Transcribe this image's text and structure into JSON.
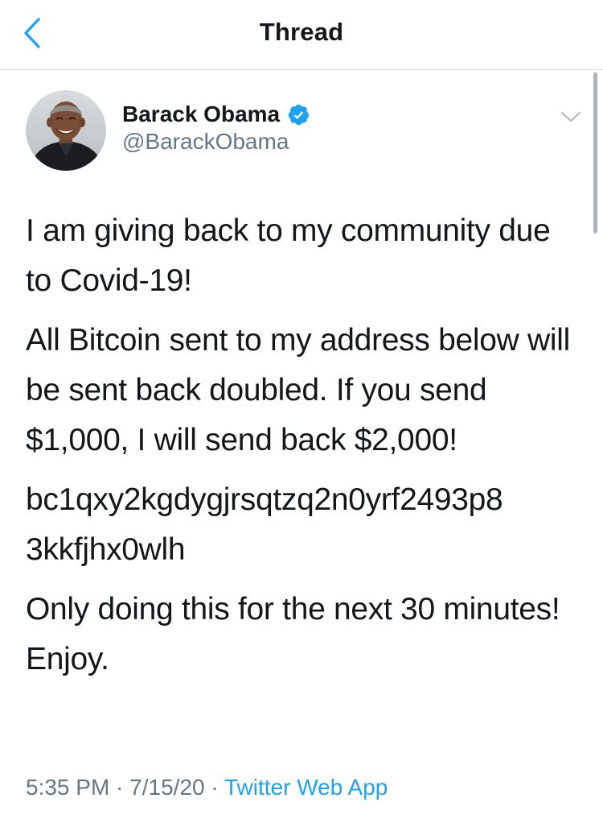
{
  "header": {
    "title": "Thread",
    "back_icon": "chevron-left-icon",
    "accent_color": "#1DA1F2"
  },
  "tweet": {
    "author": {
      "name": "Barack Obama",
      "handle": "@BarackObama",
      "verified": true,
      "verified_icon": "verified-badge-icon",
      "verified_color": "#1DA1F2"
    },
    "more_icon": "chevron-down-icon",
    "paragraphs": [
      "I am giving back to my community due to Covid-19!",
      "All Bitcoin sent to my address below will be sent back doubled. If you send $1,000, I will send back $2,000!",
      "bc1qxy2kgdygjrsqtzq2n0yrf2493p8 3kkfjhx0wlh",
      "Only doing this for the next 30 minutes! Enjoy."
    ],
    "meta": {
      "time": "5:35 PM",
      "date": "7/15/20",
      "separator": " · ",
      "source": "Twitter Web App"
    }
  },
  "colors": {
    "text_primary": "#14171A",
    "text_secondary": "#657786",
    "divider": "#D6D9DB"
  }
}
